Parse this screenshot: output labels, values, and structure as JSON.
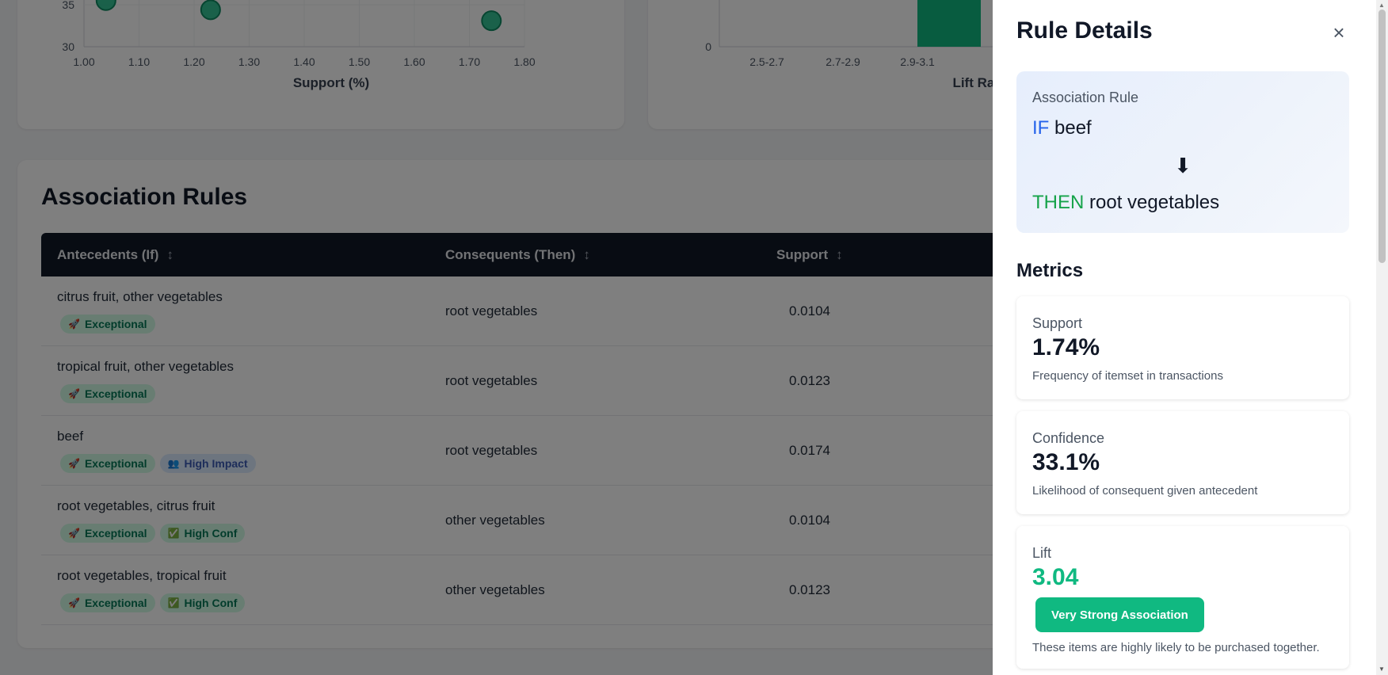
{
  "charts": {
    "scatter": {
      "x_axis_label": "Support (%)",
      "x_ticks": [
        "1.00",
        "1.10",
        "1.20",
        "1.30",
        "1.40",
        "1.50",
        "1.60",
        "1.70",
        "1.80"
      ],
      "y_ticks": [
        "35",
        "30"
      ]
    },
    "histogram": {
      "x_axis_label": "Lift Range",
      "x_ticks": [
        "2.5-2.7",
        "2.7-2.9",
        "2.9-3.1"
      ],
      "y_ticks": [
        "0"
      ]
    }
  },
  "chart_data": [
    {
      "type": "scatter",
      "xlabel": "Support (%)",
      "ylabel": "",
      "xlim": [
        1.0,
        1.8
      ],
      "ylim": [
        30,
        35
      ],
      "x_ticks": [
        "1.00",
        "1.10",
        "1.20",
        "1.30",
        "1.40",
        "1.50",
        "1.60",
        "1.70",
        "1.80"
      ],
      "y_ticks": [
        "30",
        "35"
      ],
      "grid": true,
      "points": [
        {
          "x": 1.04,
          "y": 35.5
        },
        {
          "x": 1.23,
          "y": 34.4
        },
        {
          "x": 1.74,
          "y": 33.1
        }
      ],
      "color": "#10b981"
    },
    {
      "type": "bar",
      "xlabel": "Lift Range",
      "categories": [
        "2.5-2.7",
        "2.7-2.9",
        "2.9-3.1"
      ],
      "y_ticks": [
        "0"
      ],
      "color": "#10b981"
    }
  ],
  "rules_section": {
    "title": "Association Rules",
    "columns": [
      {
        "label": "Antecedents (If)",
        "sort_icon": "↕"
      },
      {
        "label": "Consequents (Then)",
        "sort_icon": "↕"
      },
      {
        "label": "Support",
        "sort_icon": "↕"
      }
    ],
    "rows": [
      {
        "antecedents": "citrus fruit, other vegetables",
        "consequents": "root vegetables",
        "support": "0.0104",
        "badges": [
          {
            "icon": "rocket-icon",
            "glyph": "🚀",
            "label": "Exceptional",
            "color": "green"
          }
        ]
      },
      {
        "antecedents": "tropical fruit, other vegetables",
        "consequents": "root vegetables",
        "support": "0.0123",
        "badges": [
          {
            "icon": "rocket-icon",
            "glyph": "🚀",
            "label": "Exceptional",
            "color": "green"
          }
        ]
      },
      {
        "antecedents": "beef",
        "consequents": "root vegetables",
        "support": "0.0174",
        "badges": [
          {
            "icon": "rocket-icon",
            "glyph": "🚀",
            "label": "Exceptional",
            "color": "green"
          },
          {
            "icon": "people-icon",
            "glyph": "👥",
            "label": "High Impact",
            "color": "blue"
          }
        ]
      },
      {
        "antecedents": "root vegetables, citrus fruit",
        "consequents": "other vegetables",
        "support": "0.0104",
        "badges": [
          {
            "icon": "rocket-icon",
            "glyph": "🚀",
            "label": "Exceptional",
            "color": "green"
          },
          {
            "icon": "check-icon",
            "glyph": "✅",
            "label": "High Conf",
            "color": "green"
          }
        ]
      },
      {
        "antecedents": "root vegetables, tropical fruit",
        "consequents": "other vegetables",
        "support": "0.0123",
        "badges": [
          {
            "icon": "rocket-icon",
            "glyph": "🚀",
            "label": "Exceptional",
            "color": "green"
          },
          {
            "icon": "check-icon",
            "glyph": "✅",
            "label": "High Conf",
            "color": "green"
          }
        ]
      }
    ]
  },
  "panel": {
    "title": "Rule Details",
    "close_icon": "×",
    "rule": {
      "label": "Association Rule",
      "if_keyword": "IF",
      "antecedent": "beef",
      "arrow": "⬇",
      "then_keyword": "THEN",
      "consequent": "root vegetables"
    },
    "metrics_title": "Metrics",
    "support": {
      "label": "Support",
      "value": "1.74%",
      "desc": "Frequency of itemset in transactions"
    },
    "confidence": {
      "label": "Confidence",
      "value": "33.1%",
      "desc": "Likelihood of consequent given antecedent"
    },
    "lift": {
      "label": "Lift",
      "value": "3.04",
      "strength": "Very Strong Association",
      "desc": "These items are highly likely to be purchased together."
    }
  },
  "colors": {
    "accent_green": "#10b981",
    "keyword_blue": "#2563eb",
    "keyword_green": "#16a34a",
    "table_header": "#111827"
  }
}
